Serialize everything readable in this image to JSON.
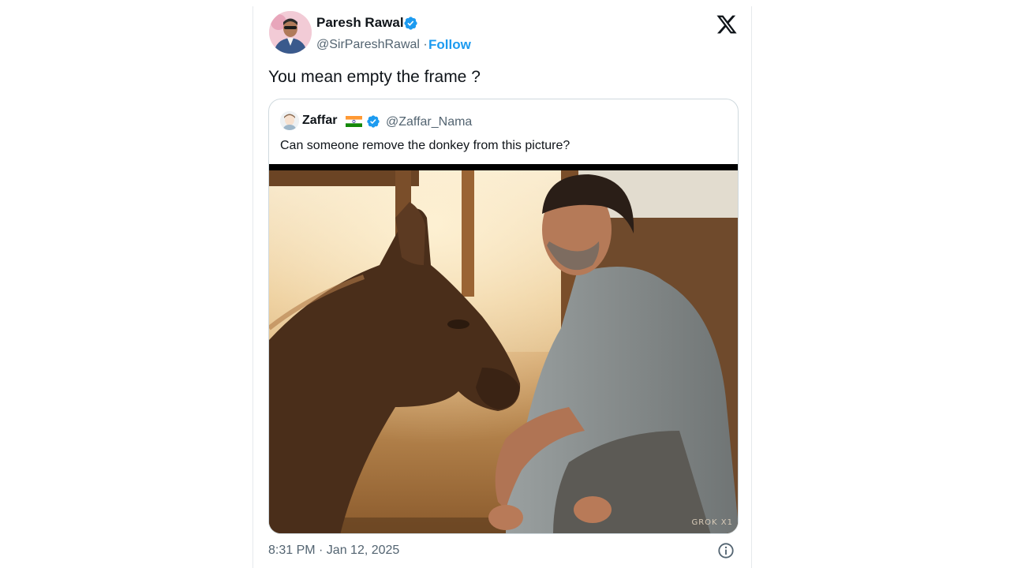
{
  "tweet": {
    "author": {
      "name": "Paresh Rawal",
      "handle": "@SirPareshRawal",
      "separator": " · ",
      "follow_label": "Follow"
    },
    "text": "You mean empty the frame ?",
    "timestamp": "8:31 PM · Jan 12, 2025",
    "icons": {
      "brand": "x-logo-icon",
      "verified": "verified-badge-icon",
      "info": "info-icon"
    }
  },
  "quoted_tweet": {
    "author": {
      "name": "Zaffar",
      "flag": "india-flag-icon",
      "handle": "@Zaffar_Nama"
    },
    "text": "Can someone remove the donkey from this picture?",
    "image": {
      "content": "man-and-donkey-photo",
      "watermark": "GROK X1"
    }
  },
  "colors": {
    "link": "#1d9bf0",
    "secondary_text": "#536471",
    "border": "#cfd9de"
  }
}
